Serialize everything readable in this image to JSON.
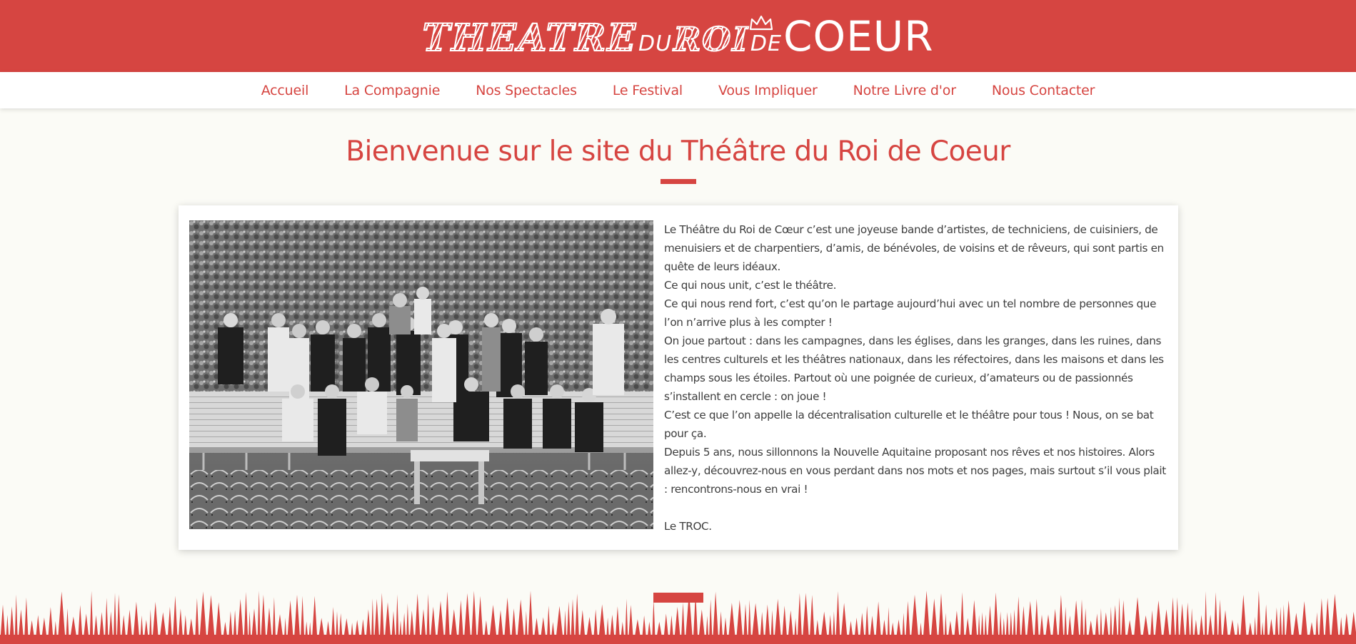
{
  "site": {
    "logo_part1": "THEATRE",
    "logo_part2": "DU",
    "logo_part3": "ROI",
    "logo_part4": "DE",
    "logo_part5": "COEUR",
    "brand_color": "#d64541"
  },
  "nav": {
    "items": [
      {
        "label": "Accueil"
      },
      {
        "label": "La Compagnie"
      },
      {
        "label": "Nos Spectacles"
      },
      {
        "label": "Le Festival"
      },
      {
        "label": "Vous Impliquer"
      },
      {
        "label": "Notre Livre d'or"
      },
      {
        "label": "Nous Contacter"
      }
    ]
  },
  "main": {
    "title": "Bienvenue sur le site du Théâtre du Roi de Coeur",
    "paragraphs": [
      "Le Théâtre du Roi de Cœur c’est une joyeuse bande d’artistes, de techniciens, de cuisiniers, de menuisiers et de charpentiers, d’amis, de bénévoles, de voisins et de rêveurs, qui sont partis en quête de leurs idéaux.",
      "Ce qui nous unit, c’est le théâtre.",
      "Ce qui nous rend fort, c’est qu’on le partage aujourd’hui avec un tel nombre de personnes que l’on n’arrive plus à les compter !",
      "On joue partout : dans les campagnes, dans les églises, dans les granges, dans les ruines, dans les centres culturels et les théâtres nationaux, dans les réfectoires, dans les maisons et dans les champs sous les étoiles. Partout où une poignée de curieux, d’amateurs ou de passionnés s’installent en cercle : on joue !",
      "C’est ce que l’on appelle la décentralisation culturelle et le théâtre pour tous ! Nous, on se bat pour ça.",
      "Depuis 5 ans, nous sillonnons la Nouvelle Aquitaine proposant nos rêves et nos histoires. Alors allez-y, découvrez-nous en vous perdant dans nos mots et nos pages, mais surtout s’il vous plait : rencontrons-nous en vrai !"
    ],
    "signature": "Le TROC."
  }
}
